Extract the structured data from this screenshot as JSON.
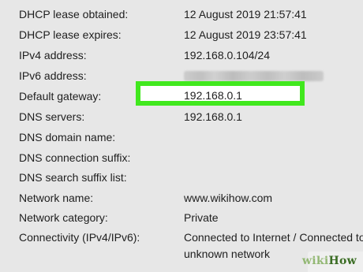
{
  "properties": [
    {
      "label": "DHCP lease obtained:",
      "value": "12 August 2019 21:57:41"
    },
    {
      "label": "DHCP lease expires:",
      "value": "12 August 2019 23:57:41"
    },
    {
      "label": "IPv4 address:",
      "value": "192.168.0.104/24"
    },
    {
      "label": "IPv6 address:",
      "value": ""
    },
    {
      "label": "Default gateway:",
      "value": "192.168.0.1"
    },
    {
      "label": "DNS servers:",
      "value": "192.168.0.1"
    },
    {
      "label": "DNS domain name:",
      "value": ""
    },
    {
      "label": "DNS connection suffix:",
      "value": ""
    },
    {
      "label": "DNS search suffix list:",
      "value": ""
    },
    {
      "label": "Network name:",
      "value": "www.wikihow.com"
    },
    {
      "label": "Network category:",
      "value": "Private"
    },
    {
      "label": "Connectivity (IPv4/IPv6):",
      "value": "Connected to Internet / Connected to unknown network"
    }
  ],
  "highlight": {
    "color": "#41e81e"
  },
  "watermark": {
    "wiki": "wiki",
    "how": "How"
  }
}
